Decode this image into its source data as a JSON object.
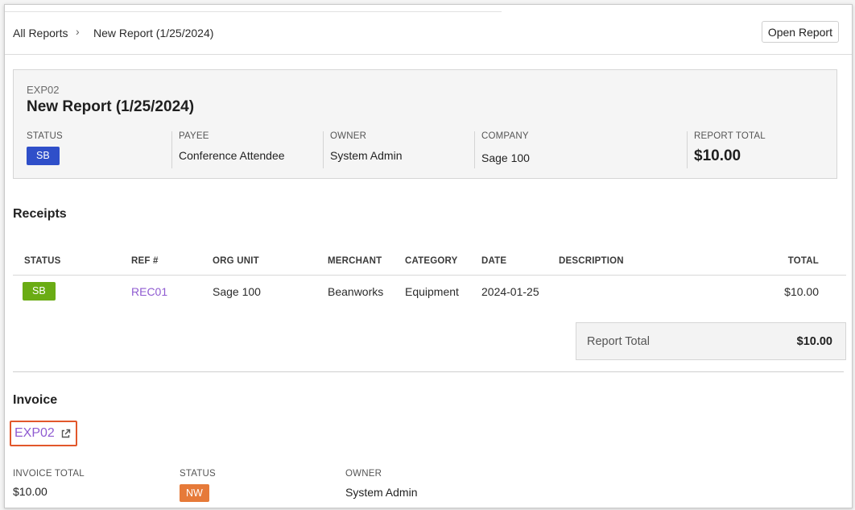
{
  "breadcrumb": {
    "root": "All Reports",
    "separator": "›",
    "current": "New Report (1/25/2024)"
  },
  "toolbar": {
    "open_report_label": "Open Report"
  },
  "report": {
    "code": "EXP02",
    "title": "New Report (1/25/2024)",
    "fields": {
      "status_label": "STATUS",
      "status_value": "SB",
      "payee_label": "PAYEE",
      "payee_value": "Conference Attendee",
      "owner_label": "OWNER",
      "owner_value": "System Admin",
      "company_label": "COMPANY",
      "company_value": "Sage 100",
      "total_label": "REPORT TOTAL",
      "total_value": "$10.00"
    }
  },
  "receipts": {
    "title": "Receipts",
    "columns": [
      "STATUS",
      "REF #",
      "ORG UNIT",
      "MERCHANT",
      "CATEGORY",
      "DATE",
      "DESCRIPTION",
      "TOTAL"
    ],
    "rows": [
      {
        "status": "SB",
        "ref": "REC01",
        "org_unit": "Sage 100",
        "merchant": "Beanworks",
        "category": "Equipment",
        "date": "2024-01-25",
        "description": "",
        "total": "$10.00"
      }
    ],
    "report_total_label": "Report Total",
    "report_total_value": "$10.00"
  },
  "invoice": {
    "title": "Invoice",
    "link_text": "EXP02",
    "total_label": "INVOICE TOTAL",
    "total_value": "$10.00",
    "status_label": "STATUS",
    "status_value": "NW",
    "owner_label": "OWNER",
    "owner_value": "System Admin"
  },
  "colors": {
    "status_sb_header": "#2f4fc9",
    "status_sb_receipt": "#6aac14",
    "status_nw": "#e67a39",
    "link": "#8f5bd1",
    "highlight_border": "#e2572b"
  },
  "icons": {
    "breadcrumb_separator": "chevron-right-icon",
    "invoice_link": "external-link-icon"
  }
}
